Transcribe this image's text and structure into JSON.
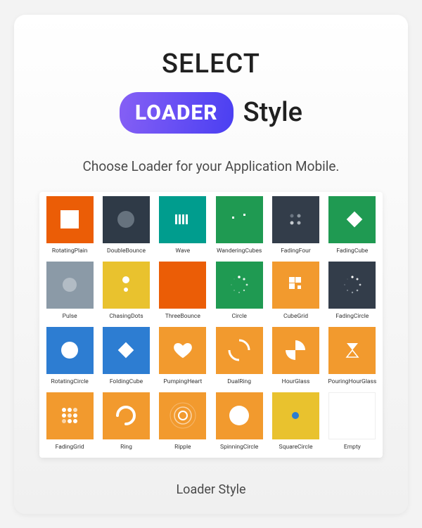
{
  "title": {
    "select": "SELECT",
    "loader": "LOADER",
    "style": "Style"
  },
  "subtitle": "Choose Loader for your Application Mobile.",
  "footer": "Loader Style",
  "colors": {
    "slate": "#2f3a47",
    "teal": "#009d8e",
    "green": "#1f9a52",
    "gray": "#8b9aa7",
    "yellow": "#e9c22e",
    "orange": "#eb5d06",
    "orange2": "#f29a2e",
    "blue": "#2d7dd2"
  },
  "items": {
    "i0": {
      "label": "RotatingPlain"
    },
    "i1": {
      "label": "DoubleBounce"
    },
    "i2": {
      "label": "Wave"
    },
    "i3": {
      "label": "WanderingCubes"
    },
    "i4": {
      "label": "FadingFour"
    },
    "i5": {
      "label": "FadingCube"
    },
    "i6": {
      "label": "Pulse"
    },
    "i7": {
      "label": "ChasingDots"
    },
    "i8": {
      "label": "ThreeBounce"
    },
    "i9": {
      "label": "Circle"
    },
    "i10": {
      "label": "CubeGrid"
    },
    "i11": {
      "label": "FadingCircle"
    },
    "i12": {
      "label": "RotatingCircle"
    },
    "i13": {
      "label": "FoldingCube"
    },
    "i14": {
      "label": "PumpingHeart"
    },
    "i15": {
      "label": "DualRing"
    },
    "i16": {
      "label": "HourGlass"
    },
    "i17": {
      "label": "PouringHourGlass"
    },
    "i18": {
      "label": "FadingGrid"
    },
    "i19": {
      "label": "Ring"
    },
    "i20": {
      "label": "Ripple"
    },
    "i21": {
      "label": "SpinningCircle"
    },
    "i22": {
      "label": "SquareCircle"
    },
    "i23": {
      "label": "Empty"
    }
  }
}
